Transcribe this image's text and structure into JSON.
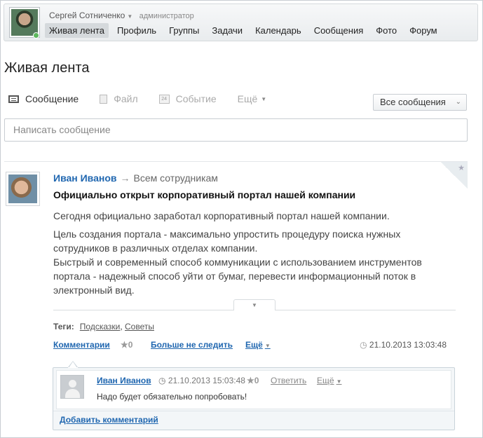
{
  "header": {
    "user_name": "Сергей Сотниченко",
    "user_role": "администратор",
    "nav": [
      {
        "label": "Живая лента",
        "active": true
      },
      {
        "label": "Профиль"
      },
      {
        "label": "Группы"
      },
      {
        "label": "Задачи"
      },
      {
        "label": "Календарь"
      },
      {
        "label": "Сообщения"
      },
      {
        "label": "Фото"
      },
      {
        "label": "Форум"
      }
    ]
  },
  "page_title": "Живая лента",
  "post_form": {
    "tabs": [
      {
        "label": "Сообщение",
        "icon": "message-icon",
        "active": true
      },
      {
        "label": "Файл",
        "icon": "file-icon"
      },
      {
        "label": "Событие",
        "icon": "calendar-icon",
        "icon_text": "24"
      },
      {
        "label": "Ещё",
        "icon": "chevron-down-icon"
      }
    ],
    "filter_label": "Все сообщения",
    "compose_placeholder": "Написать сообщение"
  },
  "post": {
    "author": "Иван Иванов",
    "destination": "Всем сотрудникам",
    "title": "Официально открыт корпоративный портал нашей компании",
    "paragraph1": "Сегодня официально заработал корпоративный портал нашей компании.",
    "paragraph2_lines": [
      "Цель создания портала - максимально упростить процедуру поиска нужных",
      "сотрудников в различных отделах компании.",
      "Быстрый и современный способ коммуникации с использованием инструментов",
      "портала - надежный способ уйти от бумаг, перевести информационный поток в",
      "электронный вид."
    ],
    "tags_label": "Теги:",
    "tags": [
      "Подсказки",
      "Советы"
    ],
    "comments_link": "Комментарии",
    "likes": "0",
    "unfollow": "Больше не следить",
    "more": "Ещё",
    "date": "21.10.2013 13:03:48"
  },
  "comment": {
    "author": "Иван Иванов",
    "time": "21.10.2013 15:03:48",
    "likes": "0",
    "reply": "Ответить",
    "more": "Ещё",
    "text": "Надо будет обязательно попробовать!"
  },
  "add_comment": "Добавить комментарий",
  "colors": {
    "link": "#2067b0",
    "online": "#5db75d"
  }
}
